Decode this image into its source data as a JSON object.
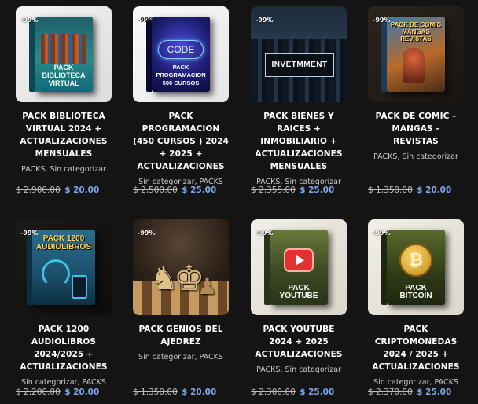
{
  "products": [
    {
      "badge": "-99%",
      "image_label": "PACK BIBLIOTECA VIRTUAL",
      "title_lines": [
        "PACK BIBLIOTECA",
        "VIRTUAL 2024 +",
        "ACTUALIZACIONES",
        "MENSUALES"
      ],
      "categories": "PACKS, Sin categorizar",
      "old_price": "$ 2,900.00",
      "new_price": "$ 20.00"
    },
    {
      "badge": "-99%",
      "image_label": "PACK PROGRAMACION 500 CURSOS",
      "image_word": "CODE",
      "title_lines": [
        "PACK",
        "PROGRAMACION",
        "(450 CURSOS ) 2024",
        "+ 2025 +",
        "ACTUALIZACIONES"
      ],
      "categories": "Sin categorizar, PACKS",
      "old_price": "$ 2,500.00",
      "new_price": "$ 25.00"
    },
    {
      "badge": "-99%",
      "image_label": "INVETMMENT",
      "title_lines": [
        "PACK BIENES Y",
        "RAICES +",
        "INMOBILIARIO +",
        "ACTUALIZACIONES",
        "MENSUALES"
      ],
      "categories": "PACKS, Sin categorizar",
      "old_price": "$ 2,355.00",
      "new_price": "$ 25.00"
    },
    {
      "badge": "-99%",
      "image_label": "PACK DE COMIC MANGAS REVISTAS",
      "title_lines": [
        "PACK DE COMIC –",
        "MANGAS –",
        "REVISTAS"
      ],
      "categories": "PACKS, Sin categorizar",
      "old_price": "$ 1,350.00",
      "new_price": "$ 20.00"
    },
    {
      "badge": "-99%",
      "image_label": "PACK 1200 AUDIOLIBROS",
      "title_lines": [
        "PACK 1200",
        "AUDIOLIBROS",
        "2024/2025 +",
        "ACTUALIZACIONES"
      ],
      "categories": "Sin categorizar, PACKS",
      "old_price": "$ 2,200.00",
      "new_price": "$ 20.00"
    },
    {
      "badge": "-99%",
      "image_label": "",
      "title_lines": [
        "PACK GENIOS DEL",
        "AJEDREZ"
      ],
      "categories": "Sin categorizar, PACKS",
      "old_price": "$ 1,350.00",
      "new_price": "$ 20.00"
    },
    {
      "badge": "-99%",
      "image_label": "PACK YOUTUBE",
      "title_lines": [
        "PACK YOUTUBE",
        "2024 + 2025",
        "ACTUALIZACIONES"
      ],
      "categories": "PACKS, Sin categorizar",
      "old_price": "$ 2,300.00",
      "new_price": "$ 25.00"
    },
    {
      "badge": "-99%",
      "image_label": "PACK BITCOIN",
      "title_lines": [
        "PACK",
        "CRIPTOMONEDAS",
        "2024 / 2025 +",
        "ACTUALIZACIONES"
      ],
      "categories": "Sin categorizar, PACKS",
      "old_price": "$ 2,370.00",
      "new_price": "$ 25.00"
    }
  ]
}
